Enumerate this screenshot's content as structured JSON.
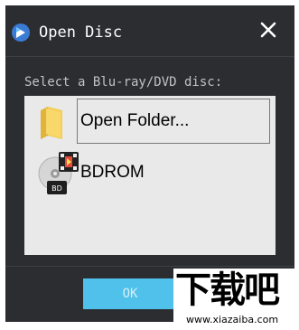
{
  "window": {
    "title": "Open Disc",
    "close_icon": "close-icon",
    "app_icon": "app-logo-icon"
  },
  "prompt": "Select a Blu-ray/DVD disc:",
  "items": [
    {
      "label": "Open Folder...",
      "icon": "folder-icon",
      "selected": true
    },
    {
      "label": "BDROM",
      "icon": "bd-disc-icon",
      "selected": false
    }
  ],
  "footer": {
    "ok_label": "OK"
  },
  "watermark": {
    "text": "下载吧",
    "url": "www.xiazaiba.com"
  },
  "colors": {
    "background": "#2b2d31",
    "list_bg": "#e9e9e9",
    "accent": "#4fc1ea"
  }
}
